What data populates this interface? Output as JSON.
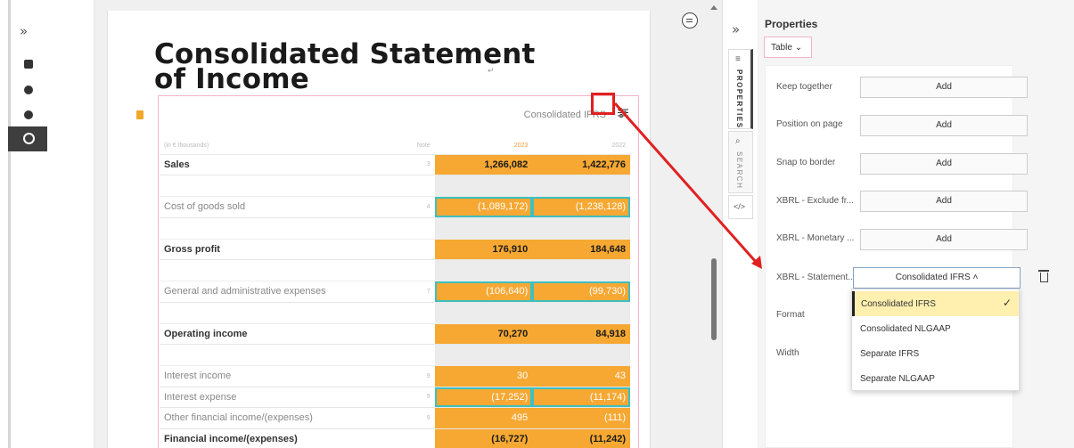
{
  "left_rail": {
    "expand_icon": "»"
  },
  "document": {
    "title_line1": "Consolidated Statement",
    "title_line2": "of Income",
    "para_mark": "↵",
    "table_label": "Consolidated IFRS",
    "header": {
      "col_label": "(in € thousands)",
      "col_note": "Note",
      "col_2023": "2023",
      "col_2022": "2022"
    },
    "rows": [
      {
        "label": "Sales",
        "note": "3",
        "v2023": "1,266,082",
        "v2022": "1,422,776"
      },
      {
        "label": "Cost of goods sold",
        "note": "4",
        "v2023": "(1,089,172)",
        "v2022": "(1,238,128)"
      },
      {
        "label": "Gross profit",
        "v2023": "176,910",
        "v2022": "184,648"
      },
      {
        "label": "General and administrative expenses",
        "note": "7",
        "v2023": "(106,640)",
        "v2022": "(99,730)"
      },
      {
        "label": "Operating income",
        "v2023": "70,270",
        "v2022": "84,918"
      },
      {
        "label": "Interest income",
        "note": "9",
        "v2023": "30",
        "v2022": "43"
      },
      {
        "label": "Interest expense",
        "note": "9",
        "v2023": "(17,252)",
        "v2022": "(11,174)"
      },
      {
        "label": "Other financial income/(expenses)",
        "note": "9",
        "v2023": "495",
        "v2022": "(111)"
      },
      {
        "label": "Financial income/(expenses)",
        "v2023": "(16,727)",
        "v2022": "(11,242)"
      }
    ]
  },
  "side_tabs": {
    "expand_icon": "»",
    "properties": "PROPERTIES",
    "search": "SEARCH",
    "code": "</>"
  },
  "properties": {
    "title": "Properties",
    "type_select": "Table",
    "fields": [
      {
        "label": "Keep together",
        "button": "Add"
      },
      {
        "label": "Position on page",
        "button": "Add"
      },
      {
        "label": "Snap to border",
        "button": "Add"
      },
      {
        "label": "XBRL - Exclude fr...",
        "button": "Add"
      },
      {
        "label": "XBRL - Monetary ...",
        "button": "Add"
      }
    ],
    "statement_label": "XBRL - Statement...",
    "statement_value": "Consolidated IFRS",
    "format_label": "Format",
    "width_label": "Width",
    "dropdown_options": [
      "Consolidated IFRS",
      "Consolidated NLGAAP",
      "Separate IFRS",
      "Separate NLGAAP"
    ],
    "selected_option": "Consolidated IFRS"
  },
  "colors": {
    "accent_orange": "#f6a833",
    "annotation_red": "#e02020",
    "selection_teal": "#3fbfbf",
    "dropdown_highlight": "#fff0b0"
  }
}
